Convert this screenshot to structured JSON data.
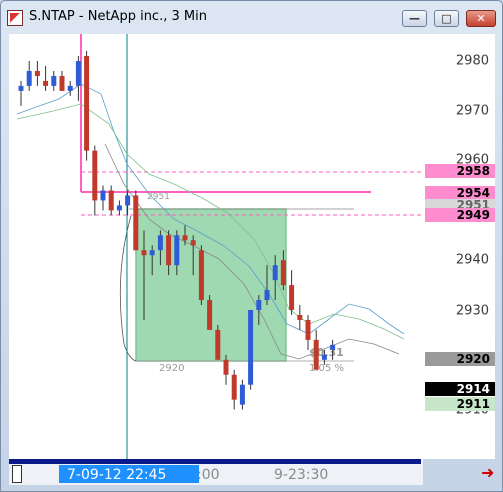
{
  "window": {
    "title": "S.NTAP - NetApp inc., 3 Min",
    "minimize_label": "—",
    "maximize_label": "□",
    "close_label": "✕"
  },
  "price_axis": {
    "labels": [
      "2980",
      "2970",
      "2960",
      "2950",
      "2940",
      "2930",
      "2920",
      "2910"
    ]
  },
  "price_tags": [
    {
      "label": "2958",
      "bg": "#ff8ccf",
      "fg": "#000000"
    },
    {
      "label": "2954",
      "bg": "#ff8ccf",
      "fg": "#000000"
    },
    {
      "label": "2951",
      "bg": "#d8d8d8",
      "fg": "#666666"
    },
    {
      "label": "2949",
      "bg": "#ff8ccf",
      "fg": "#000000"
    },
    {
      "label": "2920",
      "bg": "#9a9a9a",
      "fg": "#000000"
    },
    {
      "label": "2914",
      "bg": "#000000",
      "fg": "#ffffff"
    },
    {
      "label": "2911",
      "bg": "#c8e6c9",
      "fg": "#000000"
    }
  ],
  "annotations": {
    "box_price": "2951",
    "box_low": "2920",
    "change_value": "$0.31",
    "change_pct": "1.05 %"
  },
  "time_axis": {
    "cursor_label": "7-09-12  22:45",
    "cursor_suffix": ":00",
    "next_label": "9-23:30"
  },
  "colors": {
    "up": "#2e5cd6",
    "down": "#c0392b",
    "box_fill": "#8fd3a4",
    "pink": "#ff5fbf",
    "accent": "#0a1a8c"
  },
  "candles": [
    {
      "o": 2974,
      "h": 2976,
      "l": 2971,
      "c": 2975
    },
    {
      "o": 2975,
      "h": 2980,
      "l": 2974,
      "c": 2978
    },
    {
      "o": 2978,
      "h": 2980,
      "l": 2975,
      "c": 2977
    },
    {
      "o": 2976,
      "h": 2979,
      "l": 2974,
      "c": 2975
    },
    {
      "o": 2975,
      "h": 2978,
      "l": 2974,
      "c": 2977
    },
    {
      "o": 2977,
      "h": 2978,
      "l": 2974,
      "c": 2974
    },
    {
      "o": 2974,
      "h": 2976,
      "l": 2973,
      "c": 2975
    },
    {
      "o": 2975,
      "h": 2981,
      "l": 2972,
      "c": 2980
    },
    {
      "o": 2981,
      "h": 2982,
      "l": 2960,
      "c": 2962
    },
    {
      "o": 2962,
      "h": 2963,
      "l": 2949,
      "c": 2952
    },
    {
      "o": 2952,
      "h": 2955,
      "l": 2950,
      "c": 2954
    },
    {
      "o": 2954,
      "h": 2955,
      "l": 2949,
      "c": 2950
    },
    {
      "o": 2950,
      "h": 2952,
      "l": 2949,
      "c": 2951
    },
    {
      "o": 2951,
      "h": 2954,
      "l": 2949,
      "c": 2953
    },
    {
      "o": 2953,
      "h": 2954,
      "l": 2942,
      "c": 2942
    },
    {
      "o": 2942,
      "h": 2946,
      "l": 2928,
      "c": 2941
    },
    {
      "o": 2941,
      "h": 2943,
      "l": 2937,
      "c": 2942
    },
    {
      "o": 2942,
      "h": 2946,
      "l": 2939,
      "c": 2945
    },
    {
      "o": 2945,
      "h": 2946,
      "l": 2937,
      "c": 2939
    },
    {
      "o": 2939,
      "h": 2946,
      "l": 2937,
      "c": 2945
    },
    {
      "o": 2945,
      "h": 2947,
      "l": 2943,
      "c": 2944
    },
    {
      "o": 2944,
      "h": 2945,
      "l": 2937,
      "c": 2943
    },
    {
      "o": 2942,
      "h": 2943,
      "l": 2931,
      "c": 2932
    },
    {
      "o": 2932,
      "h": 2933,
      "l": 2926,
      "c": 2926
    },
    {
      "o": 2926,
      "h": 2927,
      "l": 2920,
      "c": 2920
    },
    {
      "o": 2920,
      "h": 2921,
      "l": 2915,
      "c": 2917
    },
    {
      "o": 2917,
      "h": 2918,
      "l": 2910,
      "c": 2912
    },
    {
      "o": 2911,
      "h": 2916,
      "l": 2910,
      "c": 2915
    },
    {
      "o": 2915,
      "h": 2930,
      "l": 2914,
      "c": 2930
    },
    {
      "o": 2930,
      "h": 2933,
      "l": 2927,
      "c": 2932
    },
    {
      "o": 2932,
      "h": 2939,
      "l": 2931,
      "c": 2934
    },
    {
      "o": 2936,
      "h": 2941,
      "l": 2932,
      "c": 2939
    },
    {
      "o": 2940,
      "h": 2942,
      "l": 2934,
      "c": 2935
    },
    {
      "o": 2935,
      "h": 2938,
      "l": 2929,
      "c": 2930
    },
    {
      "o": 2929,
      "h": 2931,
      "l": 2926,
      "c": 2928
    },
    {
      "o": 2928,
      "h": 2929,
      "l": 2922,
      "c": 2924
    },
    {
      "o": 2924,
      "h": 2926,
      "l": 2918,
      "c": 2918
    },
    {
      "o": 2920,
      "h": 2922,
      "l": 2919,
      "c": 2921
    },
    {
      "o": 2922,
      "h": 2924,
      "l": 2920,
      "c": 2923
    }
  ]
}
